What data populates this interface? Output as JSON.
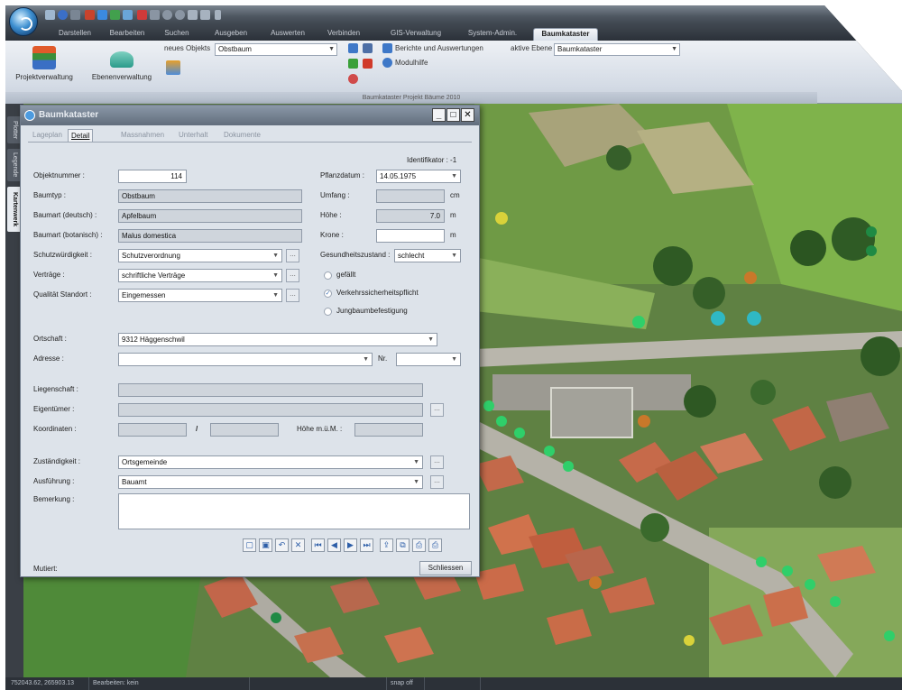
{
  "ribbon_tabs": [
    "Darstellen",
    "Bearbeiten",
    "Suchen",
    "Ausgeben",
    "Auswerten",
    "Verbinden",
    "GIS-Verwaltung",
    "System-Admin.",
    "Baumkataster"
  ],
  "ribbon": {
    "projekt_label": "Projektverwaltung",
    "ebenen_label": "Ebenenverwaltung",
    "neues_objekt_label": "neues Objekts",
    "neues_objekt_value": "Obstbaum",
    "berichte_label": "Berichte und Auswertungen",
    "modulhilfe_label": "Modulhilfe",
    "aktive_ebene_label": "aktive Ebene",
    "aktive_ebene_value": "Baumkataster",
    "group_caption": "Baumkataster  Projekt Bäume 2010"
  },
  "side_tabs": [
    "Plotter",
    "Legende",
    "Kartenwerk"
  ],
  "dialog": {
    "title": "Baumkataster",
    "tabs": [
      "Lageplan",
      "Detail",
      "Massnahmen",
      "Unterhalt",
      "Dokumente"
    ],
    "identifikator": "Identifikator : -1",
    "labels": {
      "objektnummer": "Objektnummer :",
      "baumtyp": "Baumtyp :",
      "baumart_de": "Baumart (deutsch) :",
      "baumart_bot": "Baumart (botanisch) :",
      "schutz": "Schutzwürdigkeit :",
      "vertraege": "Verträge :",
      "qualitaet": "Qualität Standort :",
      "pflanzdatum": "Pflanzdatum :",
      "umfang": "Umfang :",
      "hoehe": "Höhe :",
      "krone": "Krone :",
      "gesundheit": "Gesundheitszustand :",
      "ortschaft": "Ortschaft :",
      "adresse": "Adresse :",
      "nr": "Nr.",
      "liegenschaft": "Liegenschaft :",
      "eigentuemer": "Eigentümer :",
      "koordinaten": "Koordinaten :",
      "koord_sep": "/",
      "hoehe_mgm": "Höhe m.ü.M. :",
      "zustaendigkeit": "Zuständigkeit :",
      "ausfuehrung": "Ausführung :",
      "bemerkung": "Bemerkung :",
      "mutiert": "Mutiert:"
    },
    "values": {
      "objektnummer": "114",
      "baumtyp": "Obstbaum",
      "baumart_de": "Apfelbaum",
      "baumart_bot": "Malus domestica",
      "schutz": "Schutzverordnung",
      "vertraege": "schriftliche Verträge",
      "qualitaet": "Eingemessen",
      "pflanzdatum": "14.05.1975",
      "umfang": "",
      "hoehe": "7.0",
      "krone": "",
      "gesundheit": "schlecht",
      "ortschaft": "9312 Häggenschwil",
      "zustaendigkeit": "Ortsgemeinde",
      "ausfuehrung": "Bauamt"
    },
    "units": {
      "umfang": "cm",
      "hoehe": "m",
      "krone": "m"
    },
    "checks": [
      {
        "label": "gefällt",
        "checked": false
      },
      {
        "label": "Verkehrssicherheitspflicht",
        "checked": true
      },
      {
        "label": "Jungbaumbefestigung",
        "checked": false
      }
    ],
    "close_label": "Schliessen"
  },
  "status_bar": {
    "coords": "752043.62, 265903.13",
    "bearbeiten": "Bearbeiten: kein",
    "snap": "snap off"
  },
  "colors": {
    "tree_green": "#2fcf6a",
    "tree_cyan": "#2fb8c4",
    "tree_orange": "#c9782a",
    "tree_yellow": "#d9d23a",
    "active_tab": "#e4e9ef"
  }
}
